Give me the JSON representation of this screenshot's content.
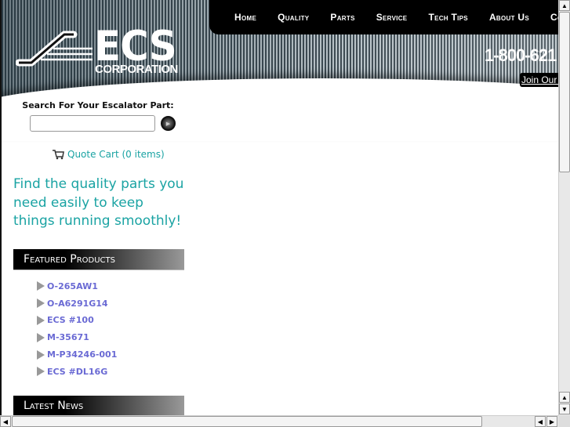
{
  "nav": {
    "items": [
      "Home",
      "Quality",
      "Parts",
      "Service",
      "Tech Tips",
      "About Us",
      "Cont"
    ]
  },
  "logo": {
    "text": "ECS",
    "subtext": "CORPORATION"
  },
  "header": {
    "phone": "1-800-621",
    "join_link": "Join Our M"
  },
  "search": {
    "label": "Search For Your Escalator Part:",
    "value": "",
    "placeholder": ""
  },
  "cart": {
    "label": "Quote Cart (0 items)",
    "icon": "cart-icon"
  },
  "tagline": "Find the quality parts you need easily to keep things running smoothly!",
  "featured": {
    "title": "Featured Products",
    "items": [
      "O-265AW1",
      "O-A6291G14",
      "ECS #100",
      "M-35671",
      "M-P34246-001",
      "ECS #DL16G"
    ]
  },
  "news": {
    "title": "Latest News"
  },
  "colors": {
    "accent": "#1aa3a3",
    "link": "#6a6ad4",
    "nav_bg": "#000000"
  }
}
